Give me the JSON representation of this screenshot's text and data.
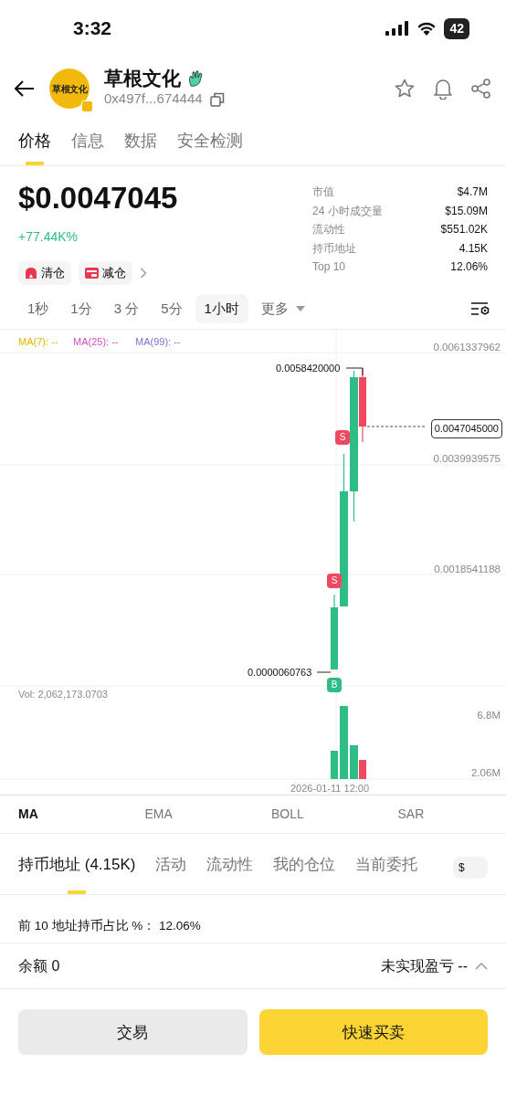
{
  "status_bar": {
    "time": "3:32",
    "battery": "42"
  },
  "header": {
    "logo_text": "草根文化",
    "title": "草根文化",
    "address": "0x497f...674444"
  },
  "tabs": [
    {
      "label": "价格",
      "selected": true
    },
    {
      "label": "信息",
      "selected": false
    },
    {
      "label": "数据",
      "selected": false
    },
    {
      "label": "安全检测",
      "selected": false
    }
  ],
  "price": {
    "value": "$0.0047045",
    "change": "+77.44K%"
  },
  "tags": [
    {
      "label": "清仓",
      "kind": "clear"
    },
    {
      "label": "减仓",
      "kind": "reduce"
    }
  ],
  "stats": [
    {
      "label": "市值",
      "value": "$4.7M"
    },
    {
      "label": "24 小时成交量",
      "value": "$15.09M"
    },
    {
      "label": "流动性",
      "value": "$551.02K"
    },
    {
      "label": "持币地址",
      "value": "4.15K"
    },
    {
      "label": "Top 10",
      "value": "12.06%"
    }
  ],
  "intervals": [
    {
      "label": "1秒",
      "selected": false,
      "kind": "plain"
    },
    {
      "label": "1分",
      "selected": false,
      "kind": "plain"
    },
    {
      "label": "3 分",
      "selected": false,
      "kind": "plain"
    },
    {
      "label": "5分",
      "selected": false,
      "kind": "plain"
    },
    {
      "label": "1小时",
      "selected": true,
      "kind": "plain"
    },
    {
      "label": "更多",
      "selected": false,
      "kind": "menu"
    }
  ],
  "chart": {
    "ma_legend": [
      {
        "label": "MA(7): --",
        "color": "#e8b400"
      },
      {
        "label": "MA(25): --",
        "color": "#d94fc4"
      },
      {
        "label": "MA(99): --",
        "color": "#8a6fd0"
      }
    ],
    "y_labels": [
      "0.0061337962",
      "0.0039939575",
      "0.0018541188"
    ],
    "high_label": "0.0058420000",
    "low_label": "0.0000060763",
    "current_price": "0.0047045000",
    "markers": [
      {
        "text": "S",
        "kind": "sell"
      },
      {
        "text": "S",
        "kind": "sell"
      },
      {
        "text": "B",
        "kind": "buy"
      }
    ],
    "volume_label": "Vol: 2,062,173.0703",
    "volume_ticks": [
      "6.8M",
      "2.06M"
    ],
    "time_label": "2026-01-11 12:00"
  },
  "indicators": [
    {
      "label": "MA",
      "selected": true
    },
    {
      "label": "EMA",
      "selected": false
    },
    {
      "label": "BOLL",
      "selected": false
    },
    {
      "label": "SAR",
      "selected": false
    }
  ],
  "bottom_tabs": [
    {
      "label": "持币地址 (4.15K)",
      "selected": true
    },
    {
      "label": "活动",
      "selected": false
    },
    {
      "label": "流动性",
      "selected": false
    },
    {
      "label": "我的仓位",
      "selected": false
    },
    {
      "label": "当前委托",
      "selected": false
    }
  ],
  "currency_toggle": {
    "label": "$",
    "on": false
  },
  "top10": "前 10 地址持币占比 %： 12.06%",
  "balance": {
    "label": "余额 0",
    "pnl": "未实现盈亏 --"
  },
  "buttons": [
    {
      "label": "交易",
      "kind": "secondary"
    },
    {
      "label": "快速买卖",
      "kind": "primary"
    }
  ]
}
